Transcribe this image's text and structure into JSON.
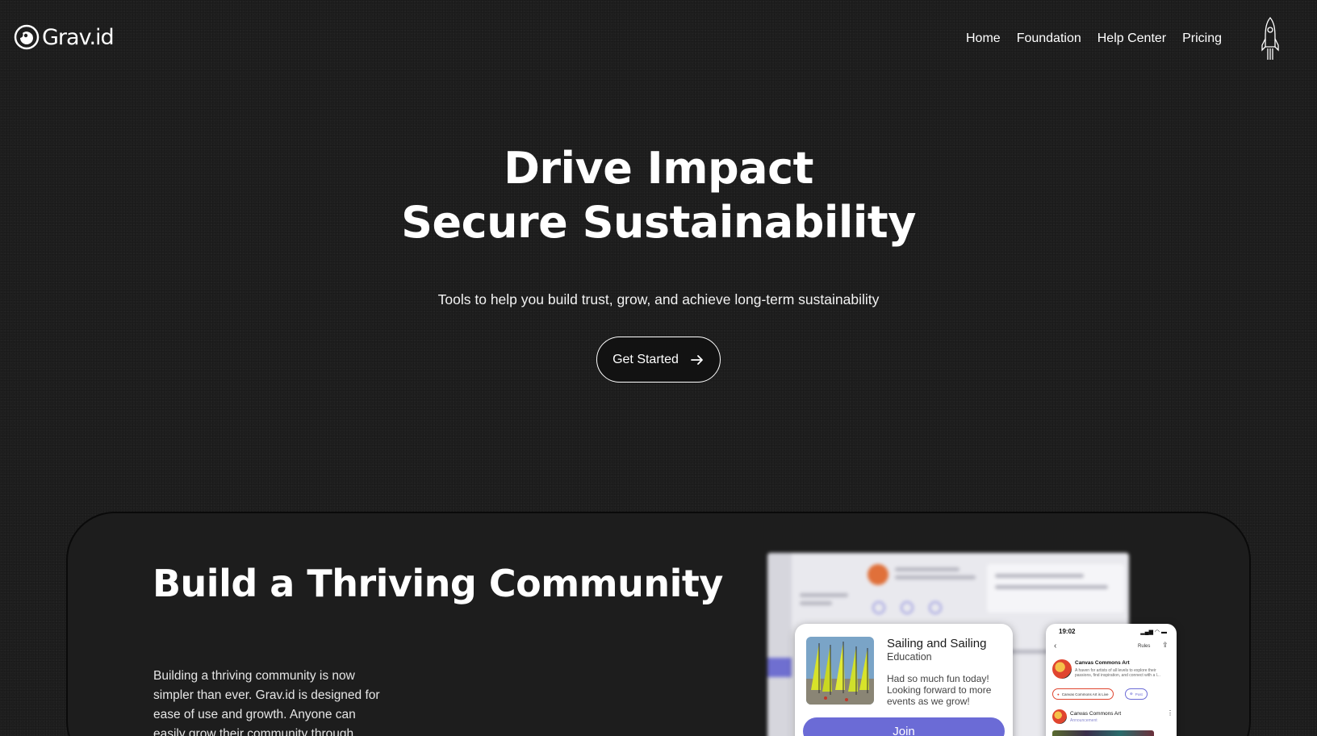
{
  "header": {
    "logo_text": "Grav.id",
    "nav": [
      "Home",
      "Foundation",
      "Help Center",
      "Pricing"
    ]
  },
  "hero": {
    "title_line1": "Drive Impact",
    "title_line2": "Secure Sustainability",
    "subtitle": "Tools to help you build trust, grow, and achieve long-term sustainability",
    "cta_label": "Get Started"
  },
  "section": {
    "title": "Build a Thriving Community",
    "body": "Building a thriving community is now simpler than ever. Grav.id is designed for ease of use and growth. Anyone can easily grow their community through"
  },
  "popup": {
    "title": "Sailing and Sailing",
    "category": "Education",
    "text": "Had so much fun today! Looking forward to more events as we grow!",
    "join_label": "Join"
  },
  "phone": {
    "time": "19:02",
    "rules_label": "Rules",
    "community_name": "Canvas Commons Art",
    "community_desc": "A haven for artists of all levels to explore their passions, find inspiration, and connect with a l...",
    "live_pill": "Canvas Commons Art is Live",
    "post_pill": "Post",
    "post_author": "Canvas Commons Art",
    "post_type": "Announcement"
  },
  "colors": {
    "background": "#1f1f1f",
    "accent": "#6b6bd6",
    "live_pill": "#e0452f"
  },
  "icons": [
    "logo-icon",
    "rocket-icon",
    "arrow-right-icon",
    "back-icon",
    "share-icon",
    "more-icon"
  ]
}
